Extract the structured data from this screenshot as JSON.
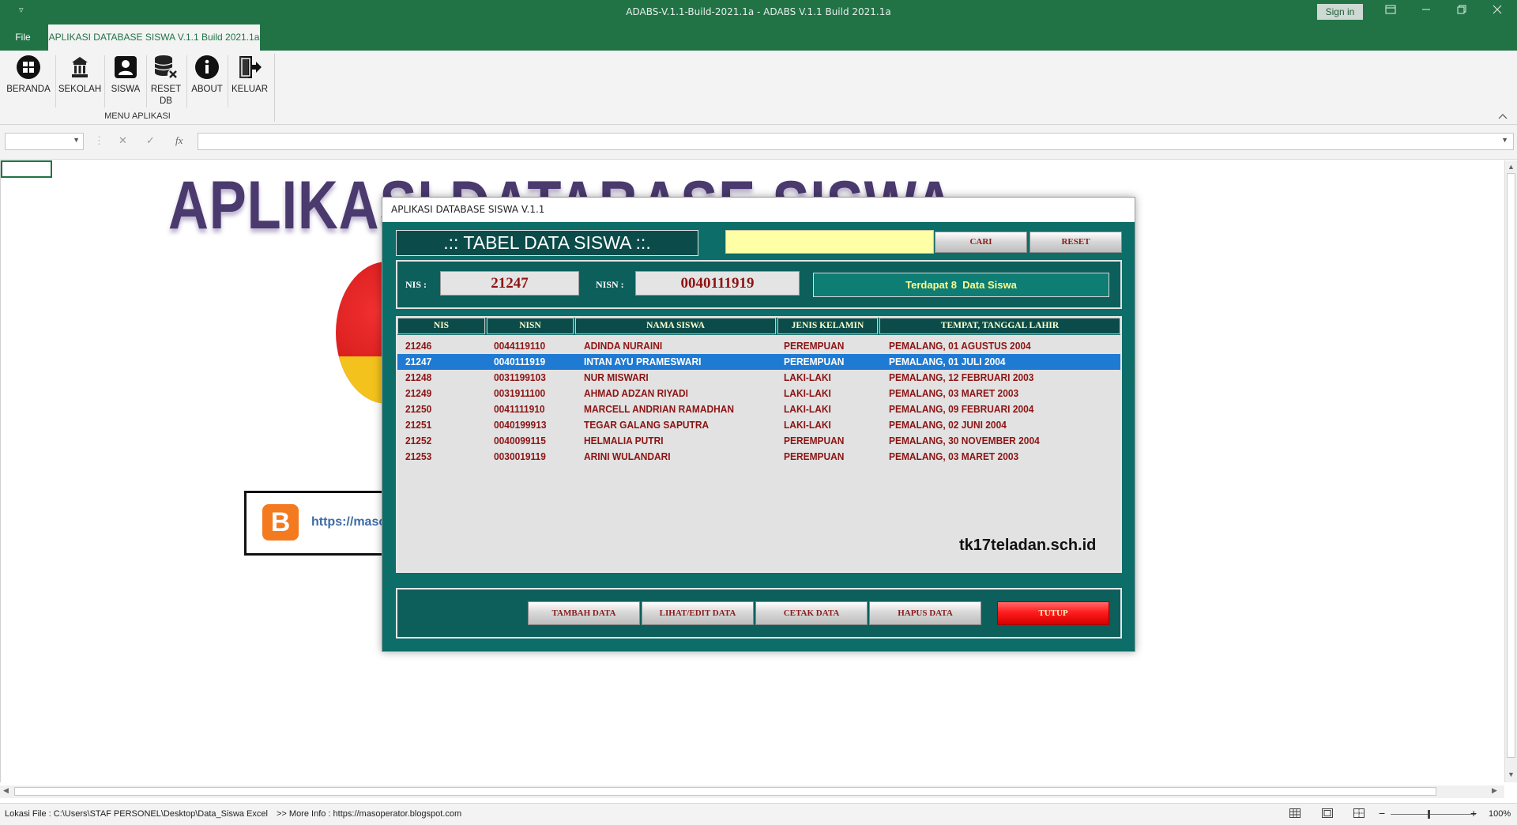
{
  "window": {
    "title": "ADABS-V.1.1-Build-2021.1a  -  ADABS V.1.1 Build 2021.1a",
    "sign_in": "Sign in",
    "quick_access": "▿"
  },
  "tabs": {
    "file": "File",
    "app": "APLIKASI DATABASE SISWA V.1.1 Build 2021.1a"
  },
  "ribbon": {
    "group_label": "MENU APLIKASI",
    "buttons": [
      {
        "label": "BERANDA",
        "icon": "windows-icon"
      },
      {
        "label": "SEKOLAH",
        "icon": "school-icon"
      },
      {
        "label": "SISWA",
        "icon": "student-icon"
      },
      {
        "label": "RESET",
        "label2": "DB",
        "icon": "database-reset-icon"
      },
      {
        "label": "ABOUT",
        "icon": "info-icon"
      },
      {
        "label": "KELUAR",
        "icon": "exit-icon"
      }
    ]
  },
  "formula_bar": {
    "cancel": "✕",
    "enter": "✓",
    "fx": "fx"
  },
  "sheet": {
    "banner": "APLIKASI DATABASE SISWA",
    "link_text": "https://masoperator.blogspot.com"
  },
  "dialog": {
    "title": "APLIKASI DATABASE SISWA V.1.1",
    "table_title": ".:: TABEL DATA SISWA ::.",
    "search_value": "",
    "cari_label": "CARI",
    "reset_label": "RESET",
    "nis_label": "NIS :",
    "nis_value": "21247",
    "nisn_label": "NISN :",
    "nisn_value": "0040111919",
    "count_text": "Terdapat 8  Data Siswa",
    "columns": [
      "NIS",
      "NISN",
      "NAMA SISWA",
      "JENIS KELAMIN",
      "TEMPAT, TANGGAL LAHIR"
    ],
    "rows": [
      {
        "nis": "21246",
        "nisn": "0044119110",
        "nama": "ADINDA NURAINI",
        "jk": "PEREMPUAN",
        "ttl": "PEMALANG, 01 AGUSTUS 2004"
      },
      {
        "nis": "21247",
        "nisn": "0040111919",
        "nama": "INTAN AYU PRAMESWARI",
        "jk": "PEREMPUAN",
        "ttl": "PEMALANG, 01 JULI 2004"
      },
      {
        "nis": "21248",
        "nisn": "0031199103",
        "nama": "NUR MISWARI",
        "jk": "LAKI-LAKI",
        "ttl": "PEMALANG, 12 FEBRUARI 2003"
      },
      {
        "nis": "21249",
        "nisn": "0031911100",
        "nama": "AHMAD ADZAN RIYADI",
        "jk": "LAKI-LAKI",
        "ttl": "PEMALANG, 03 MARET 2003"
      },
      {
        "nis": "21250",
        "nisn": "0041111910",
        "nama": "MARCELL ANDRIAN RAMADHAN",
        "jk": "LAKI-LAKI",
        "ttl": "PEMALANG, 09 FEBRUARI 2004"
      },
      {
        "nis": "21251",
        "nisn": "0040199913",
        "nama": "TEGAR GALANG SAPUTRA",
        "jk": "LAKI-LAKI",
        "ttl": "PEMALANG, 02 JUNI 2004"
      },
      {
        "nis": "21252",
        "nisn": "0040099115",
        "nama": "HELMALIA PUTRI",
        "jk": "PEREMPUAN",
        "ttl": "PEMALANG, 30 NOVEMBER 2004"
      },
      {
        "nis": "21253",
        "nisn": "0030019119",
        "nama": "ARINI WULANDARI",
        "jk": "PEREMPUAN",
        "ttl": "PEMALANG, 03 MARET 2003"
      }
    ],
    "selected_row": 1,
    "watermark": "tk17teladan.sch.id",
    "buttons": {
      "tambah": "TAMBAH DATA",
      "lihat": "LIHAT/EDIT DATA",
      "cetak": "CETAK DATA",
      "hapus": "HAPUS DATA",
      "tutup": "TUTUP"
    }
  },
  "status_bar": {
    "file_path": "Lokasi File : C:\\Users\\STAF PERSONEL\\Desktop\\Data_Siswa Excel",
    "more_info": ">> More Info : https://masoperator.blogspot.com",
    "zoom": "100%"
  }
}
